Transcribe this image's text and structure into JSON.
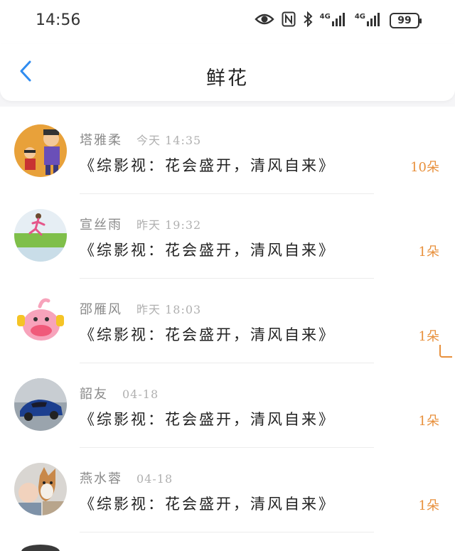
{
  "status_bar": {
    "time": "14:56",
    "battery": "99",
    "network_1": "4G",
    "network_2": "4G"
  },
  "header": {
    "title": "鲜花",
    "back_icon": "chevron-left-icon"
  },
  "colors": {
    "accent": "#e8903c",
    "back": "#2f8cf0",
    "name": "#8a8a8a",
    "time": "#b0b0b0"
  },
  "messages": [
    {
      "name": "塔雅柔",
      "time": "今天 14:35",
      "text": "《综影视：花会盛开，清风自来》",
      "count": "10朵",
      "avatar": "cartoon-kids-avatar"
    },
    {
      "name": "宣丝雨",
      "time": "昨天 19:32",
      "text": "《综影视：花会盛开，清风自来》",
      "count": "1朵",
      "avatar": "runner-avatar"
    },
    {
      "name": "邵雁风",
      "time": "昨天 18:03",
      "text": "《综影视：花会盛开，清风自来》",
      "count": "1朵",
      "avatar": "pink-pig-avatar"
    },
    {
      "name": "韶友",
      "time": "04-18",
      "text": "《综影视：花会盛开，清风自来》",
      "count": "1朵",
      "avatar": "car-avatar"
    },
    {
      "name": "燕水蓉",
      "time": "04-18",
      "text": "《综影视：花会盛开，清风自来》",
      "count": "1朵",
      "avatar": "dog-and-baby-avatar"
    }
  ]
}
